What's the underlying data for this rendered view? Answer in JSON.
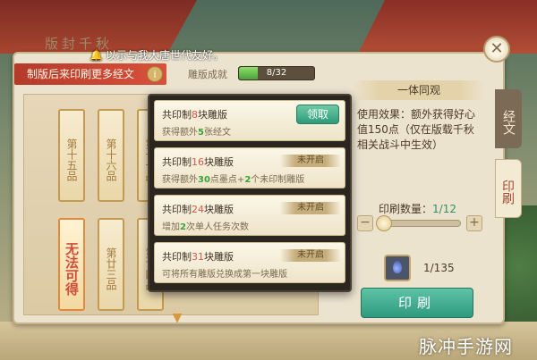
{
  "chat": {
    "message": "以示与我大唐世代友好。"
  },
  "panel": {
    "title": "版封千秋"
  },
  "header": {
    "left_title": "制版后来印刷更多经文",
    "info": "i",
    "progress_label": "雕版成就",
    "progress_text": "8/32",
    "progress_fraction": 0.25
  },
  "board": {
    "blocks_top": [
      "第十五品",
      "第十六品",
      "第十七品"
    ],
    "blocks_bottom": [
      "无法可得",
      "第廿三品",
      "第廿四品"
    ]
  },
  "rewards": [
    {
      "title_pre": "共印制",
      "title_num": "8",
      "title_post": "块雕版",
      "desc_pre": "获得额外",
      "desc_num": "5",
      "desc_post": "张经文",
      "action": "领取",
      "claimable": true
    },
    {
      "title_pre": "共印制",
      "title_num": "16",
      "title_post": "块雕版",
      "desc_pre": "获得额外",
      "desc_num": "30",
      "desc_mid": "点墨点+",
      "desc_num2": "2",
      "desc_post": "个未印制雕版",
      "action": "未开启",
      "claimable": false
    },
    {
      "title_pre": "共印制",
      "title_num": "24",
      "title_post": "块雕版",
      "desc_pre": "增加",
      "desc_num": "2",
      "desc_post": "次单人任务次数",
      "action": "未开启",
      "claimable": false
    },
    {
      "title_pre": "共印制",
      "title_num": "31",
      "title_post": "块雕版",
      "desc_pre": "可将所有雕版兑换成第一块雕版",
      "action": "未开启",
      "claimable": false
    }
  ],
  "right": {
    "title": "一体同观",
    "effect_text": "使用效果：额外获得好心值150点（仅在版载千秋相关战斗中生效）",
    "qty_label": "印刷数量：",
    "qty_value": "1/12",
    "qty_fraction": 0.0833,
    "material_count": "1/135",
    "print_button": "印刷"
  },
  "tabs": {
    "tab1": "经文",
    "tab2": "印刷"
  },
  "watermark": "脉冲手游网",
  "colors": {
    "accent_green": "#2e9a7e",
    "header_red": "#c4432f",
    "highlight_red": "#d8574a"
  }
}
